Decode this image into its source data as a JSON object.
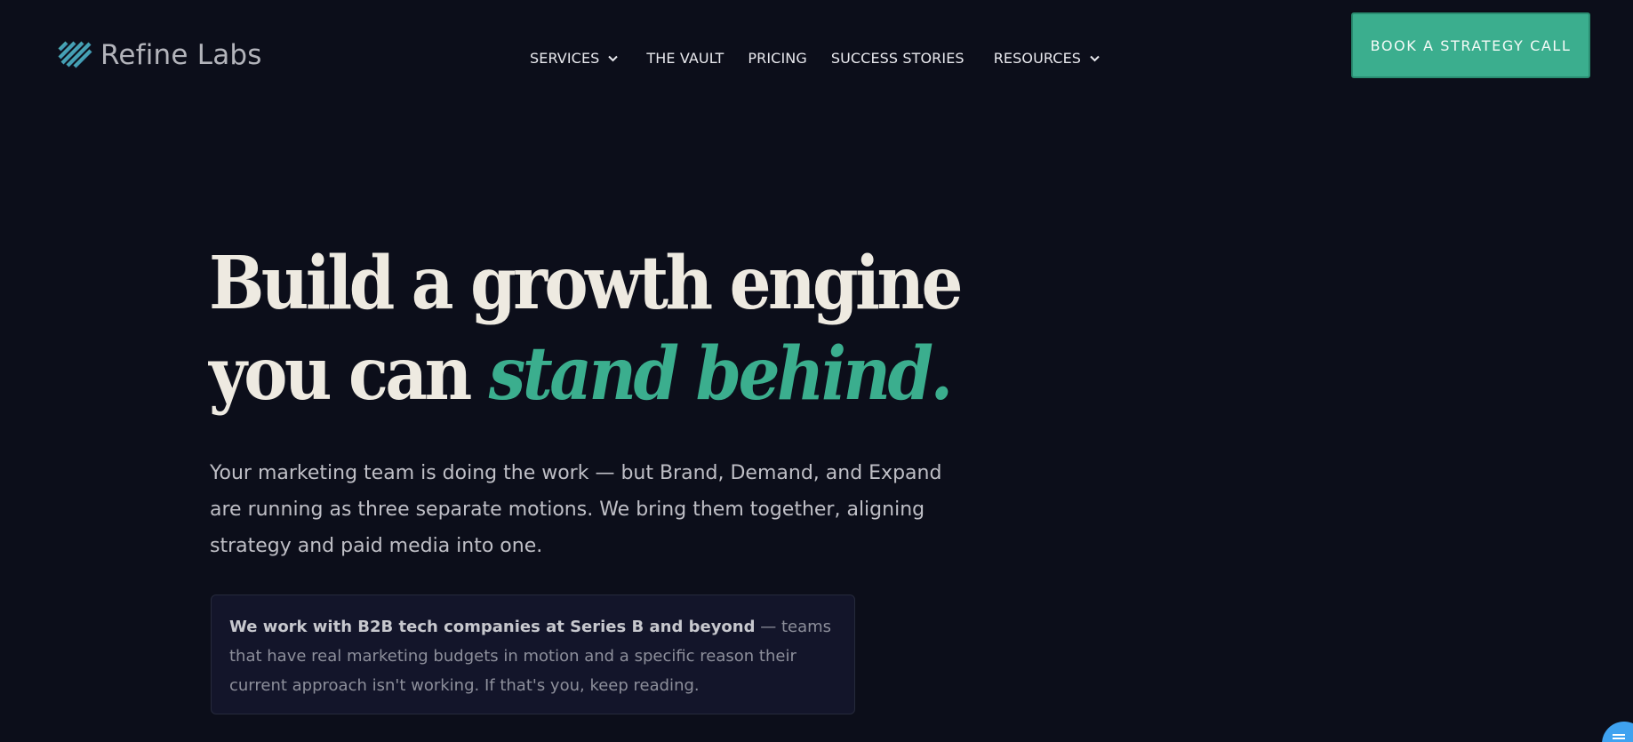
{
  "header": {
    "logo_text": "Refine Labs",
    "logo_icon": "diagonal-stripes-logo-icon",
    "nav": {
      "services": "SERVICES",
      "vault": "THE VAULT",
      "pricing": "PRICING",
      "success_stories": "SUCCESS STORIES",
      "resources": "RESOURCES"
    },
    "cta_label": "BOOK A STRATEGY CALL"
  },
  "hero": {
    "headline_line1": "Build a growth engine",
    "headline_line2_start": "you can ",
    "headline_line2_accent": "stand behind.",
    "lead": "Your marketing team is doing the work — but Brand, Demand, and Expand are running as three separate motions. We bring them together, aligning strategy and paid media into one.",
    "callout_strong": "We work with B2B tech companies at Series B and beyond",
    "callout_rest": " — teams that have real marketing budgets in motion and a specific reason their current approach isn't working. If that's you, keep reading."
  },
  "colors": {
    "background": "#0c0e1a",
    "accent": "#3bae8e",
    "headline": "#eeeae1",
    "body_text": "#bfbfc6",
    "callout_bg": "#13152a",
    "chat_widget": "#3fa2f0"
  },
  "icons": {
    "nav_dropdown": "chevron-down-icon",
    "chat": "chat-bubble-icon"
  }
}
